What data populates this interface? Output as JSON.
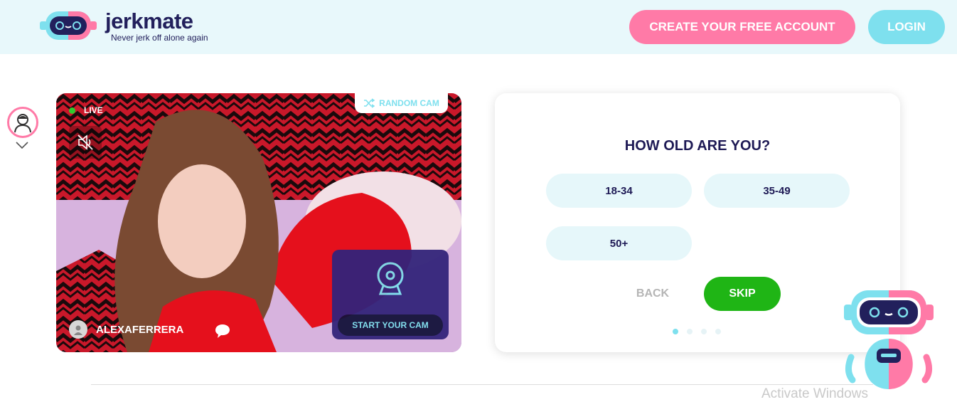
{
  "header": {
    "brand": "jerkmate",
    "tagline": "Never jerk off alone again",
    "create_account_label": "CREATE YOUR FREE ACCOUNT",
    "login_label": "LOGIN"
  },
  "video": {
    "live_label": "LIVE",
    "random_cam_label": "RANDOM CAM",
    "username": "ALEXAFERRERA",
    "start_cam_label": "START YOUR CAM"
  },
  "quiz": {
    "question": "HOW OLD ARE YOU?",
    "options": [
      "18-34",
      "35-49",
      "50+"
    ],
    "back_label": "BACK",
    "skip_label": "SKIP",
    "step_current": 1,
    "step_total": 4
  },
  "colors": {
    "pink": "#ff7aa7",
    "cyan": "#7ee0ee",
    "navy": "#1e1a55",
    "green": "#1fb515",
    "header_bg": "#e8f8fb"
  },
  "icons": [
    "robot-logo-icon",
    "user-avatar-icon",
    "chevron-down-icon",
    "mute-icon",
    "shuffle-icon",
    "user-icon",
    "chat-icon",
    "webcam-icon",
    "robot-mascot-icon"
  ],
  "system": {
    "watermark": "Activate Windows"
  }
}
